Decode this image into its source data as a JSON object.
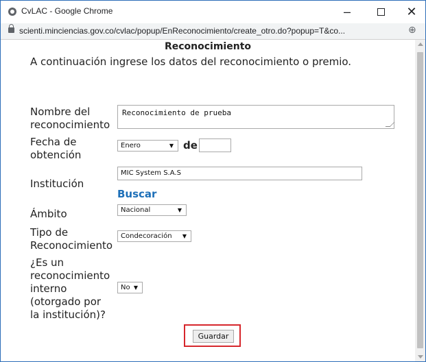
{
  "window": {
    "title": "CvLAC - Google Chrome",
    "url": "scienti.minciencias.gov.co/cvlac/popup/EnReconocimiento/create_otro.do?popup=T&co..."
  },
  "form": {
    "heading": "Reconocimiento",
    "intro": "A continuación ingrese los datos del reconocimiento o premio.",
    "nombre_label_1": "Nombre del",
    "nombre_label_2": "reconocimiento",
    "nombre_value": "Reconocimiento de prueba",
    "fecha_label_1": "Fecha de",
    "fecha_label_2": "obtención",
    "mes_value": "Enero",
    "de_label": "de",
    "anio_value": "",
    "institucion_label": "Institución",
    "institucion_value": "MIC System S.A.S",
    "buscar_label": "Buscar",
    "ambito_label": "Ámbito",
    "ambito_value": "Nacional",
    "tipo_label_1": "Tipo de",
    "tipo_label_2": "Reconocimiento",
    "tipo_value": "Condecoración",
    "interno_label_1": "¿Es un",
    "interno_label_2": "reconocimiento",
    "interno_label_3": "interno",
    "interno_label_4": "(otorgado por",
    "interno_label_5": "la institución)?",
    "interno_value": "No",
    "guardar_label": "Guardar"
  },
  "icons": {
    "window": "chrome-icon",
    "lock": "lock-icon",
    "zoom": "zoom-icon",
    "caret": "▼"
  },
  "colors": {
    "link": "#1d6fb8",
    "highlight": "#d6262b",
    "window_border": "#2b6cb8"
  }
}
